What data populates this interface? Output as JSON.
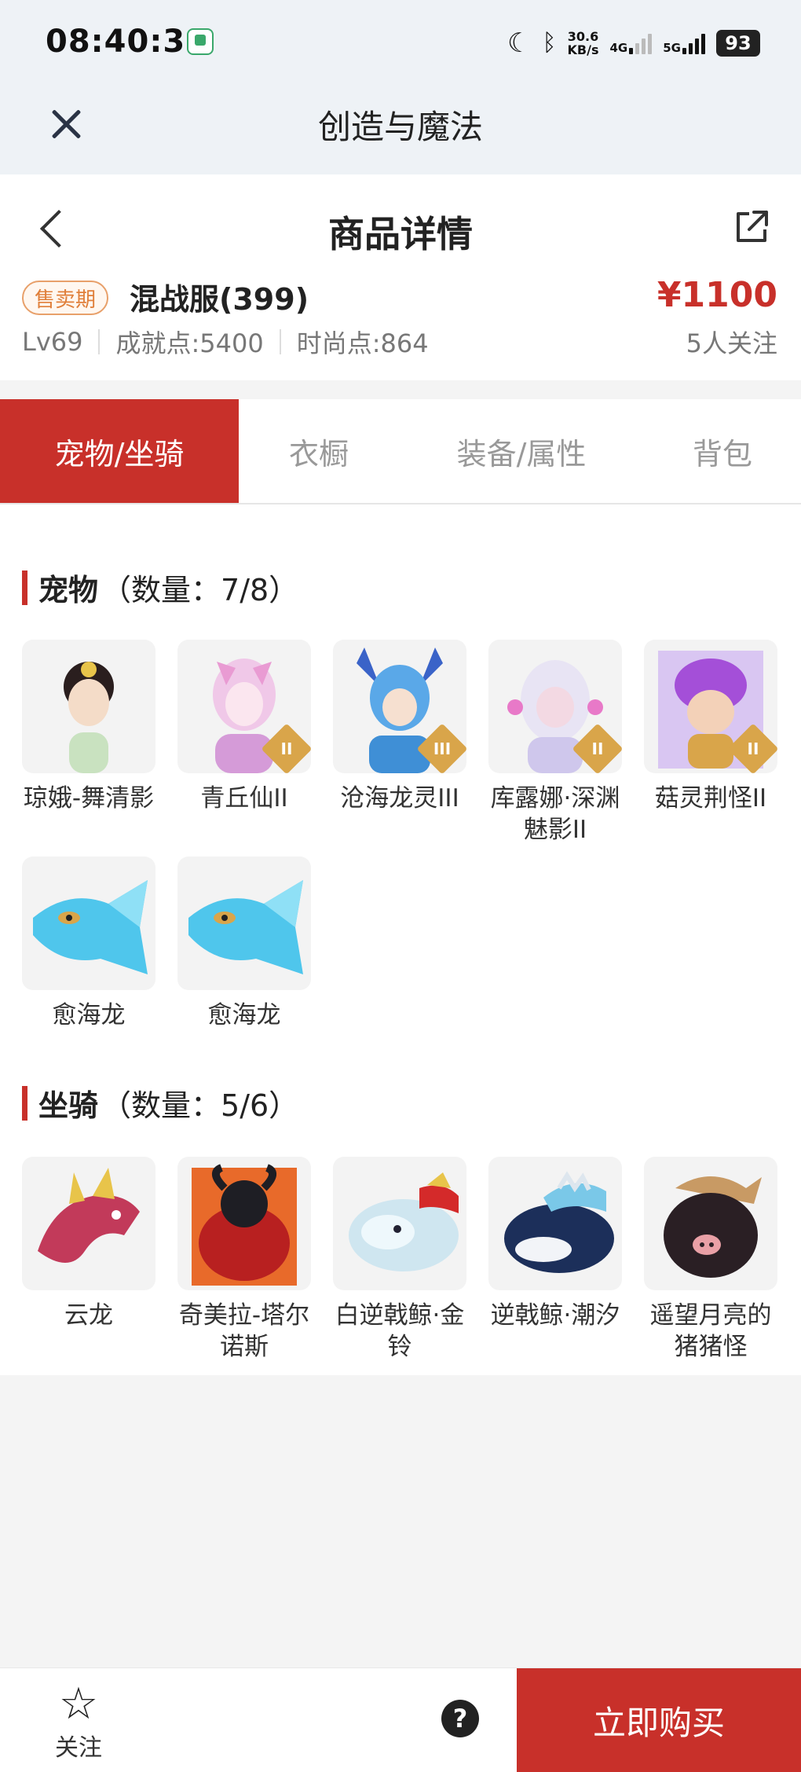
{
  "status_bar": {
    "time": "08:40:36",
    "net_speed_value": "30.6",
    "net_speed_unit": "KB/s",
    "net_4g": "4G",
    "net_5g": "5G",
    "battery": "93"
  },
  "titlebar": {
    "title": "创造与魔法"
  },
  "detail": {
    "title": "商品详情",
    "badge": "售卖期",
    "server": "混战服(399)",
    "price": "¥1100",
    "level": "Lv69",
    "achievement": "成就点:5400",
    "fashion": "时尚点:864",
    "followers": "5人关注"
  },
  "tabs": [
    "宠物/坐骑",
    "衣橱",
    "装备/属性",
    "背包"
  ],
  "pets": {
    "title": "宠物",
    "count": "（数量：7/8）",
    "items": [
      {
        "name": "琼娥-舞清影",
        "grade": ""
      },
      {
        "name": "青丘仙II",
        "grade": "II"
      },
      {
        "name": "沧海龙灵III",
        "grade": "III"
      },
      {
        "name": "库露娜·深渊魅影II",
        "grade": "II"
      },
      {
        "name": "菇灵荆怪II",
        "grade": "II"
      },
      {
        "name": "愈海龙",
        "grade": ""
      },
      {
        "name": "愈海龙",
        "grade": ""
      }
    ]
  },
  "mounts": {
    "title": "坐骑",
    "count": "（数量：5/6）",
    "items": [
      {
        "name": "云龙"
      },
      {
        "name": "奇美拉-塔尔诺斯"
      },
      {
        "name": "白逆戟鲸·金铃"
      },
      {
        "name": "逆戟鲸·潮汐"
      },
      {
        "name": "遥望月亮的猪猪怪"
      }
    ]
  },
  "bottom": {
    "follow": "关注",
    "help": "?",
    "buy": "立即购买"
  },
  "colors": {
    "accent": "#c8302a",
    "badge": "#e07f3a",
    "grade": "#d9a54a"
  }
}
